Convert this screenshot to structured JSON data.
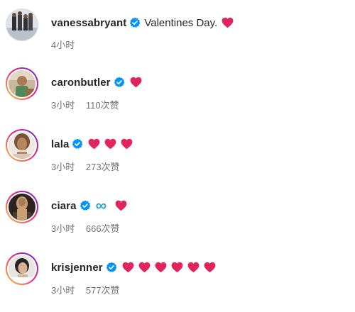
{
  "comments": [
    {
      "username": "vanessabryant",
      "text": "Valentines Day.",
      "hearts": 1,
      "time": "4小时",
      "likes": ""
    },
    {
      "username": "caronbutler",
      "text": "",
      "hearts": 1,
      "time": "3小时",
      "likes": "110次赞"
    },
    {
      "username": "lala",
      "text": "",
      "hearts": 3,
      "time": "3小时",
      "likes": "273次赞"
    },
    {
      "username": "ciara",
      "text": "∞",
      "hearts": 1,
      "time": "3小时",
      "likes": "666次赞"
    },
    {
      "username": "krisjenner",
      "text": "",
      "hearts": 6,
      "time": "3小时",
      "likes": "577次赞"
    }
  ],
  "colors": {
    "heart": "#e0245e",
    "verified": "#0095f6",
    "story_ring_start": "#f9ce34",
    "story_ring_mid": "#ee2a7b",
    "story_ring_end": "#6228d7",
    "muted_text": "#737373",
    "primary_text": "#262626",
    "infinity": "#2aa8d8"
  },
  "icons": {
    "verified": "verified-badge-icon",
    "heart": "red-heart-emoji-icon",
    "infinity": "infinity-emoji-icon"
  }
}
